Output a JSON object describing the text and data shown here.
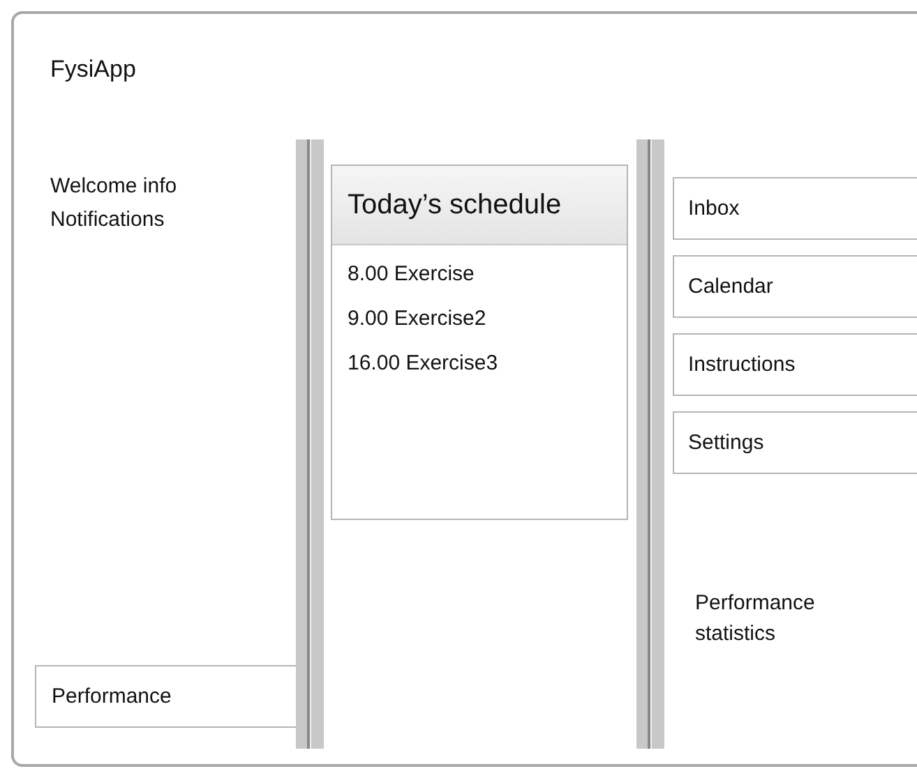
{
  "app": {
    "title": "FysiApp"
  },
  "left_panel": {
    "lines": [
      "Welcome info",
      "Notifications"
    ],
    "button": "Performance"
  },
  "schedule": {
    "title": "Today’s schedule",
    "items": [
      "8.00 Exercise",
      "9.00 Exercise2",
      "16.00 Exercise3"
    ]
  },
  "menu": [
    "Inbox",
    "Calendar",
    "Instructions",
    "Settings"
  ],
  "statistics": "Performance statistics"
}
